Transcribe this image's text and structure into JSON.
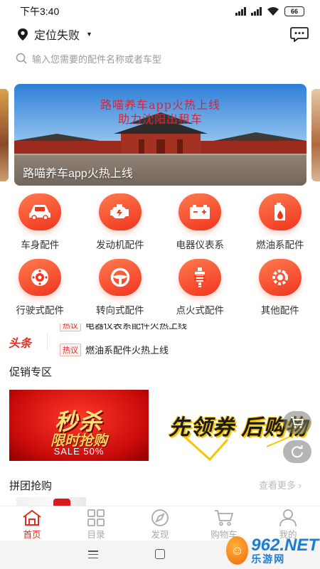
{
  "status_bar": {
    "time": "下午3:40",
    "battery": "66"
  },
  "header": {
    "location": "定位失败"
  },
  "search": {
    "placeholder": "输入您需要的配件名称或者车型"
  },
  "banner": {
    "headline_line1": "路喵养车app火热上线",
    "headline_line2": "助力沈阳出租车",
    "caption": "路喵养车app火热上线"
  },
  "categories": [
    {
      "label": "车身配件",
      "icon": "car-icon"
    },
    {
      "label": "发动机配件",
      "icon": "engine-icon"
    },
    {
      "label": "电器仪表系",
      "icon": "battery-icon"
    },
    {
      "label": "燃油系配件",
      "icon": "fuel-can-icon"
    },
    {
      "label": "行驶式配件",
      "icon": "wheel-icon"
    },
    {
      "label": "转向式配件",
      "icon": "steering-wheel-icon"
    },
    {
      "label": "点火式配件",
      "icon": "spark-plug-icon"
    },
    {
      "label": "其他配件",
      "icon": "tools-icon"
    }
  ],
  "news": {
    "logo": "头条",
    "items": [
      {
        "tag": "热议",
        "text": "电器仪表系配件火热上线"
      },
      {
        "tag": "热议",
        "text": "燃油系配件火热上线"
      }
    ]
  },
  "promotions": {
    "title": "促销专区",
    "left_banner": {
      "big_text": "秒杀",
      "sub_text": "限时抢购",
      "sale_text": "SALE 50%"
    },
    "right_banner": {
      "text": "先领券 后购物"
    }
  },
  "group_buy": {
    "title": "拼团抢购",
    "more": "查看更多 ›"
  },
  "tab_bar": [
    {
      "label": "首页",
      "icon": "home-icon",
      "active": true
    },
    {
      "label": "目录",
      "icon": "grid-icon",
      "active": false
    },
    {
      "label": "发现",
      "icon": "compass-icon",
      "active": false
    },
    {
      "label": "购物车",
      "icon": "cart-icon",
      "active": false
    },
    {
      "label": "我的",
      "icon": "user-icon",
      "active": false
    }
  ],
  "watermark": {
    "number": "962.NET",
    "text": "乐游网"
  },
  "colors": {
    "accent": "#e62c1e",
    "icon_gradient_start": "#ff7b4f",
    "icon_gradient_end": "#f0341e",
    "inactive_tab": "#aaaaaa"
  }
}
